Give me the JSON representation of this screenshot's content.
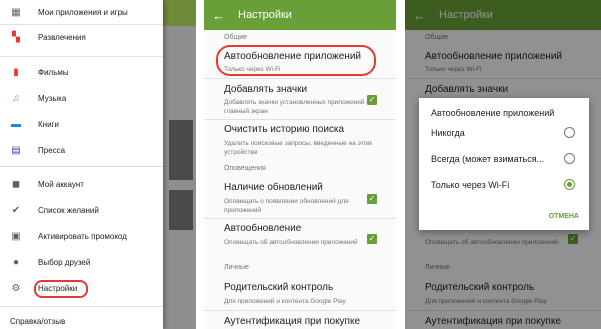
{
  "drawer": {
    "header": "Мои приложения и игры",
    "items": [
      {
        "label": "Развлечения",
        "icon": "entertainment-icon"
      },
      {
        "label": "Фильмы",
        "icon": "movies-icon"
      },
      {
        "label": "Музыка",
        "icon": "music-icon"
      },
      {
        "label": "Книги",
        "icon": "books-icon"
      },
      {
        "label": "Пресса",
        "icon": "newsstand-icon"
      },
      {
        "label": "Мой аккаунт",
        "icon": "account-icon"
      },
      {
        "label": "Список желаний",
        "icon": "wishlist-icon"
      },
      {
        "label": "Активировать промокод",
        "icon": "redeem-icon"
      },
      {
        "label": "Выбор друзей",
        "icon": "people-icon"
      },
      {
        "label": "Настройки",
        "icon": "gear-icon"
      },
      {
        "label": "Справка/отзыв",
        "icon": ""
      }
    ]
  },
  "settings": {
    "title": "Настройки",
    "section_general": "Общие",
    "auto_update_title": "Автообновление приложений",
    "auto_update_sub": "Только через Wi-Fi",
    "add_icons_title": "Добавлять значки",
    "add_icons_sub": "Добавлять значки установленных приложений на главный экран",
    "clear_history_title": "Очистить историю поиска",
    "clear_history_sub": "Удалить поисковые запросы, введенные на этом устройстве",
    "section_notifications": "Оповещения",
    "updates_title": "Наличие обновлений",
    "updates_sub": "Оповещать о появлении обновлений для приложений",
    "autoupdate_title": "Автообновление",
    "autoupdate_sub": "Оповещать об автообновлении приложений",
    "section_personal": "Личные",
    "parental_title": "Родительский контроль",
    "parental_sub": "Для приложений и контента Google Play",
    "auth_title": "Аутентификация при покупке"
  },
  "dialog": {
    "title": "Автообновление приложений",
    "options": [
      "Никогда",
      "Всегда (может взиматься...",
      "Только через Wi-Fi"
    ],
    "selected_index": 2,
    "cancel": "ОТМЕНА"
  },
  "colors": {
    "accent": "#689f38",
    "highlight": "#e53935"
  }
}
